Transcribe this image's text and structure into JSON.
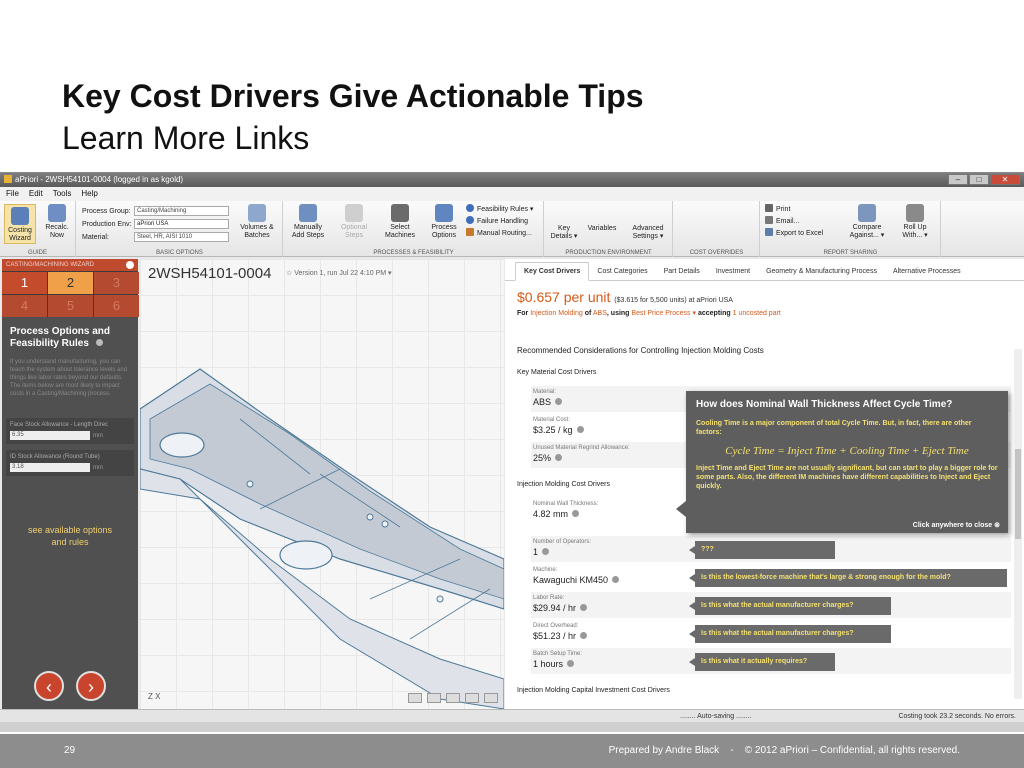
{
  "slide": {
    "title": "Key Cost Drivers Give Actionable Tips",
    "subtitle": "Learn More Links",
    "page_number": "29",
    "footer": "Prepared by Andre Black    -    © 2012 aPriori – Confidential, all rights reserved."
  },
  "window": {
    "title": "aPriori - 2WSH54101-0004 (logged in as kgold)",
    "menu": [
      "File",
      "Edit",
      "Tools",
      "Help"
    ]
  },
  "ribbon": {
    "costing_wizard": "Costing Wizard",
    "recalc_now": "Recalc. Now",
    "guide_label": "GUIDE",
    "process_group_label": "Process Group:",
    "process_group_value": "Casting/Machining",
    "production_env_label": "Production Env:",
    "production_env_value": "aPriori USA",
    "material_label": "Material:",
    "material_value": "Steel, HR, AISI 1010",
    "volumes_batches": "Volumes & Batches",
    "basic_options_label": "BASIC OPTIONS",
    "manually_add_steps": "Manually Add Steps",
    "optional_steps": "Optional Steps",
    "select_machines": "Select Machines",
    "process_options": "Process Options",
    "feasibility_rules": "Feasibility Rules",
    "failure_handling": "Failure Handling",
    "manual_routing": "Manual Routing...",
    "processes_feasibility_label": "PROCESSES & FEASIBILITY",
    "key_details": "Key Details",
    "variables": "Variables",
    "advanced_settings": "Advanced Settings",
    "production_environment_label": "PRODUCTION ENVIRONMENT",
    "cost_overrides_label": "COST OVERRIDES",
    "print": "Print",
    "email": "Email...",
    "export_excel": "Export to Excel",
    "compare_against": "Compare Against...",
    "roll_up_with": "Roll Up With...",
    "report_sharing_label": "REPORT SHARING"
  },
  "wizard": {
    "header": "CASTING/MACHINING WIZARD",
    "steps": [
      "1",
      "2",
      "3",
      "4",
      "5",
      "6"
    ],
    "title": "Process Options and Feasibility Rules",
    "description": "If you understand manufacturing, you can teach the system about tolerance levels and things like labor rates beyond our defaults. The items below are most likely to impact costs in a Casting/Machining process.",
    "input1_label": "Face Stock Allowance - Length Direc",
    "input1_value": "6.35",
    "input1_unit": "mm",
    "input2_label": "ID Stock Allowance (Round Tube)",
    "input2_value": "3.18",
    "input2_unit": "mm",
    "link": "see available options and rules"
  },
  "viewport": {
    "part_id": "2WSH54101-0004",
    "version": "Version 1, run Jul 22 4:10 PM ▾",
    "axes": "Z X"
  },
  "tabs": [
    "Key Cost Drivers",
    "Cost Categories",
    "Part Details",
    "Investment",
    "Geometry & Manufacturing Process",
    "Alternative Processes"
  ],
  "costing": {
    "price": "$0.657 per unit",
    "price_sub": "($3.615 for 5,500 units) at aPriori USA",
    "for_label": "For",
    "process": "Injection Molding",
    "of": "of",
    "material": "ABS",
    "using": ", using",
    "best_price": "Best Price Process ▾",
    "accepting": "accepting",
    "uncosted": "1 uncosted part",
    "rec_title": "Recommended Considerations for Controlling Injection Molding Costs",
    "key_material": "Key Material Cost Drivers",
    "material_label": "Material:",
    "material_value": "ABS",
    "material_cost_label": "Material Cost:",
    "material_cost_value": "$3.25 / kg",
    "regrind_label": "Unused Material Regrind Allowance:",
    "regrind_value": "25%",
    "im_drivers": "Injection Molding Cost Drivers",
    "wall_label": "Nominal Wall Thickness:",
    "wall_value": "4.82 mm",
    "operators_label": "Number of Operators:",
    "operators_value": "1",
    "machine_label": "Machine:",
    "machine_value": "Kawaguchi KM450",
    "labor_label": "Labor Rate:",
    "labor_value": "$29.94 / hr",
    "overhead_label": "Direct Overhead:",
    "overhead_value": "$51.23 / hr",
    "setup_label": "Batch Setup Time:",
    "setup_value": "1 hours",
    "capital": "Injection Molding Capital Investment Cost Drivers"
  },
  "tips": {
    "operators": "???",
    "machine": "Is this the lowest-force machine that's large & strong enough for the mold?",
    "labor": "Is this what the actual manufacturer charges?",
    "overhead": "Is this what the actual manufacturer charges?",
    "setup": "Is this what it actually requires?"
  },
  "popup": {
    "title": "How does Nominal Wall Thickness Affect Cycle Time?",
    "body1": "Cooling Time is a major component of total Cycle Time.  But, in fact, there are other factors:",
    "formula": "Cycle Time = Inject Time + Cooling Time + Eject Time",
    "body2": "Inject Time and Eject Time are not usually significant, but can start to play a bigger role for some parts.  Also, the different IM machines have different capabilities to Inject and Eject quickly.",
    "close": "Click anywhere to close"
  },
  "status": {
    "autosave": "........ Auto-saving ........",
    "right": "Costing took 23.2 seconds. No errors."
  },
  "colors": {
    "accent_orange": "#d55a1a",
    "wizard_red": "#c44b2c",
    "tip_yellow": "#f4e070"
  }
}
